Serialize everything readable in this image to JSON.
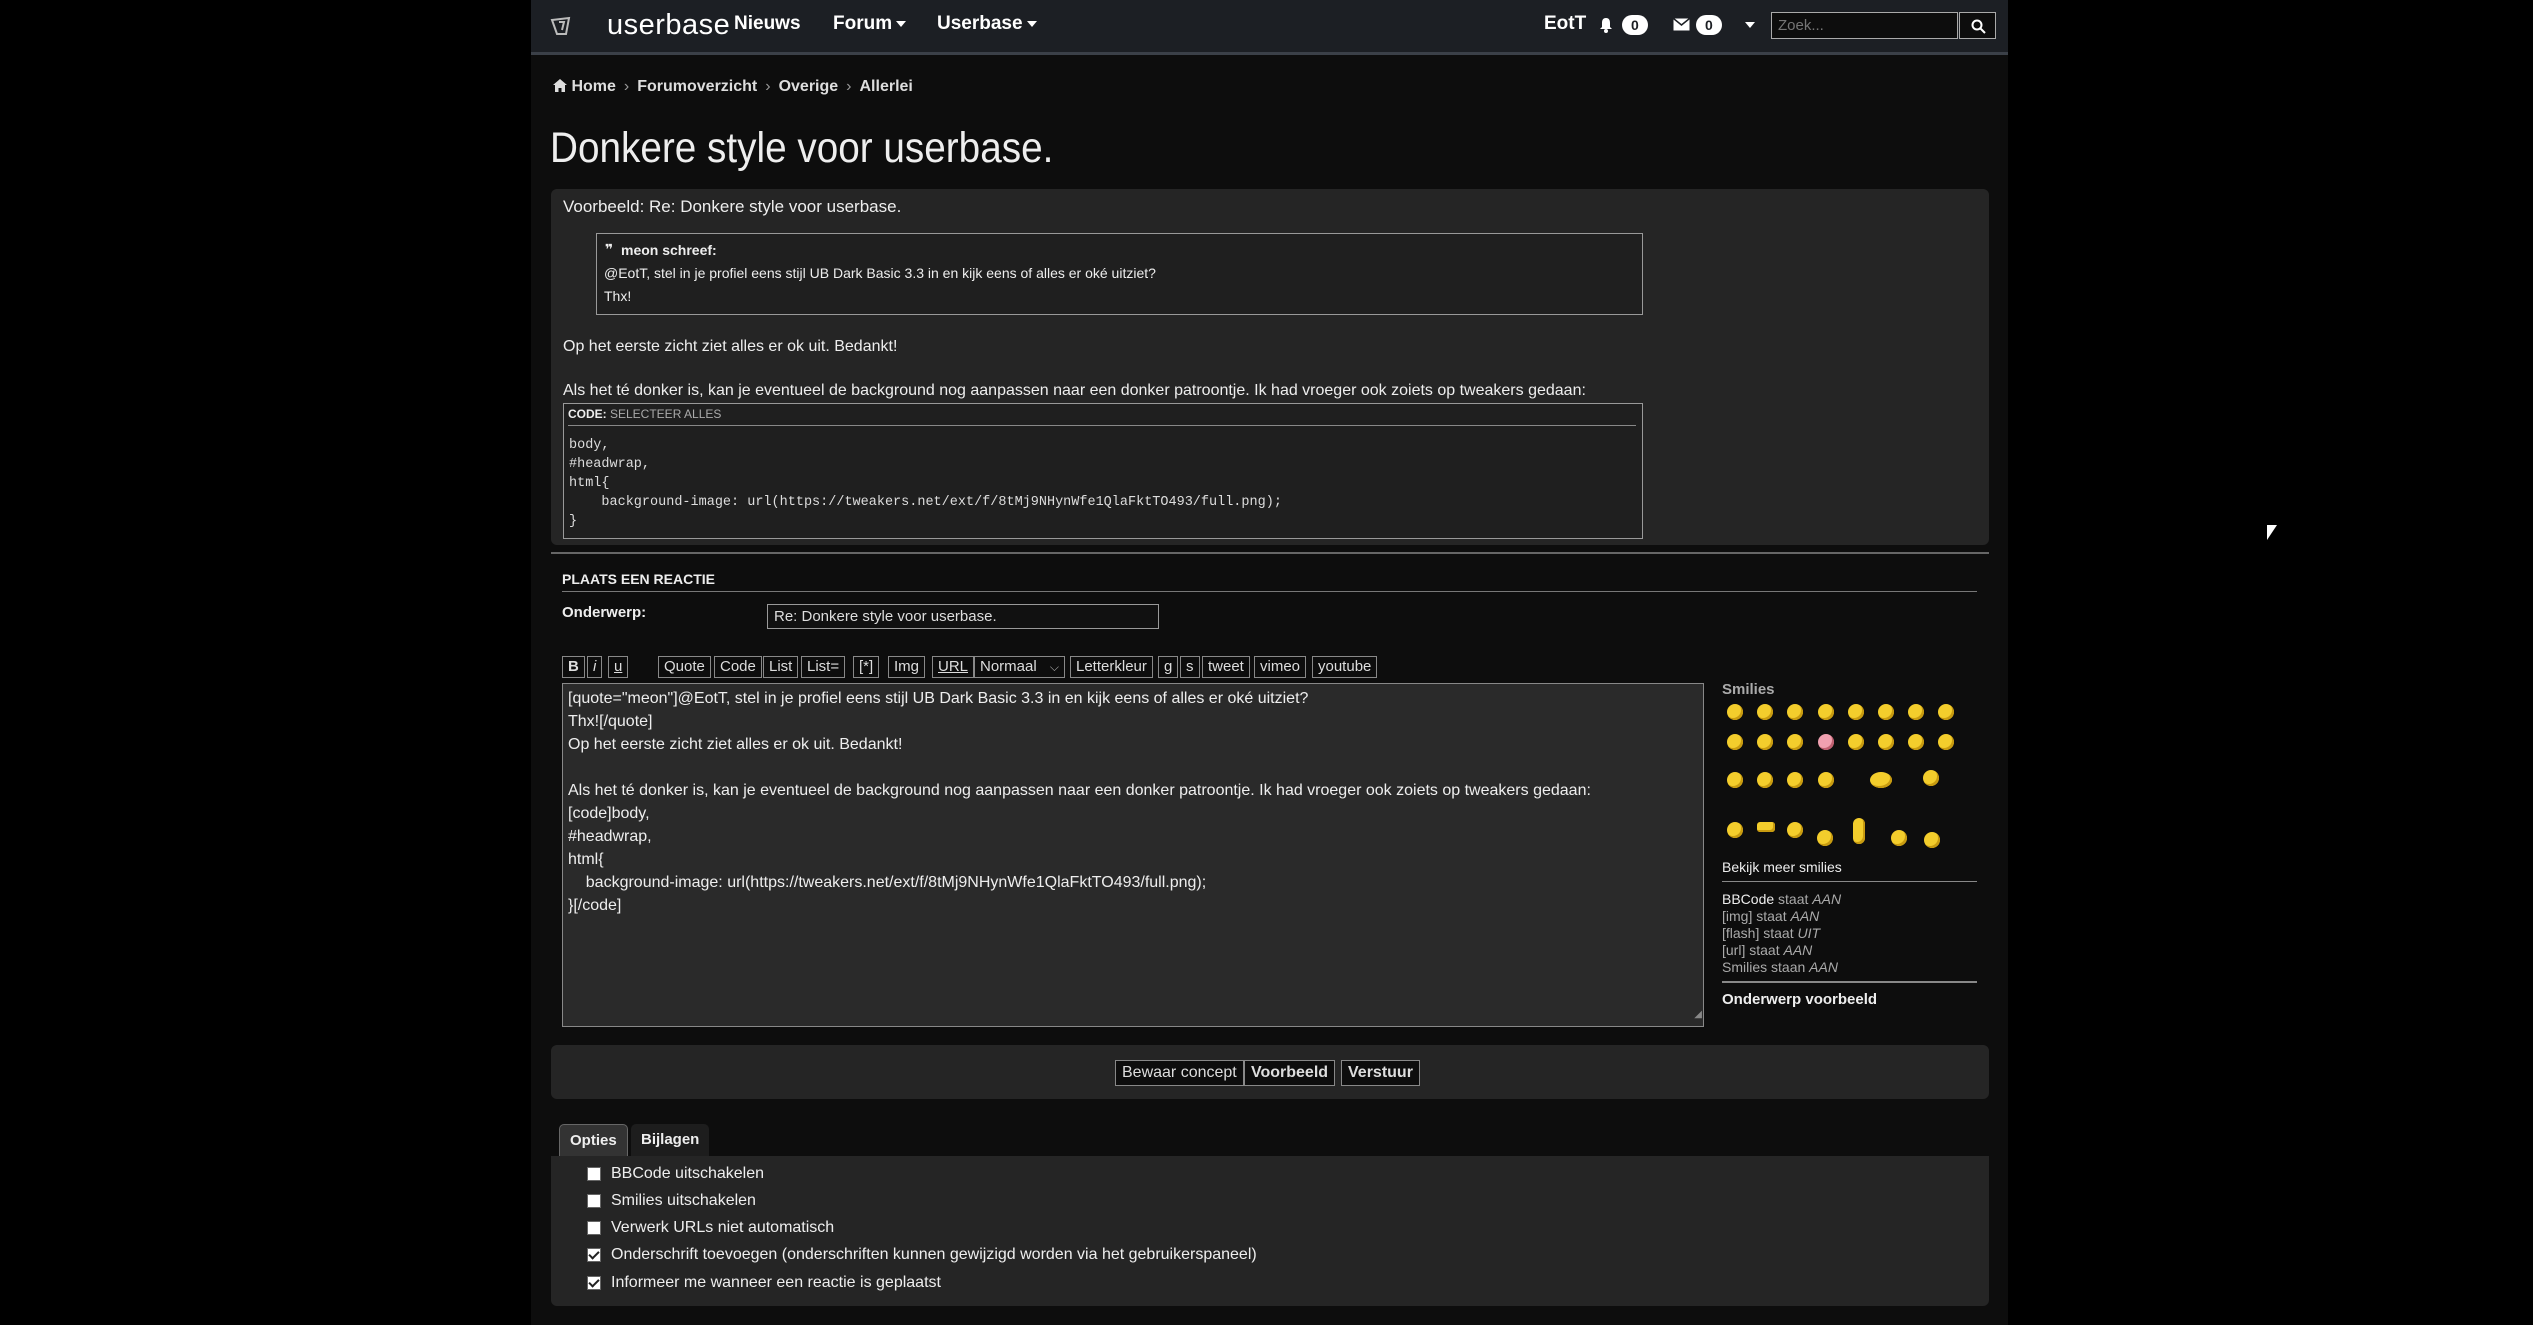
{
  "nav": {
    "logo_icon": "userbase-logo-icon",
    "logo_text": "userbase",
    "items": [
      "Nieuws",
      "Forum",
      "Userbase"
    ],
    "username": "EotT",
    "notifications_count": "0",
    "messages_count": "0",
    "search_placeholder": "Zoek...",
    "search_icon": "search-icon"
  },
  "breadcrumb": [
    "Home",
    "Forumoverzicht",
    "Overige",
    "Allerlei"
  ],
  "page_title": "Donkere style voor userbase.",
  "preview": {
    "heading": "Voorbeeld: Re: Donkere style voor userbase.",
    "quote_author": "meon schreef:",
    "quote_lines": [
      "@EotT, stel in je profiel eens stijl UB Dark Basic 3.3 in en kijk eens of alles er oké uitziet?",
      "Thx!"
    ],
    "para1": "Op het eerste zicht ziet alles er ok uit. Bedankt!",
    "para2": "Als het té donker is, kan je eventueel de background nog aanpassen naar een donker patroontje. Ik had vroeger ook zoiets op tweakers gedaan:",
    "code_label": "CODE:",
    "code_select": "SELECTEER ALLES",
    "code_lines": [
      "body,",
      "#headwrap,",
      "html{",
      "    background-image: url(https://tweakers.net/ext/f/8tMj9NHynWfe1QlaFktTO493/full.png);",
      "}"
    ]
  },
  "form": {
    "heading": "PLAATS EEN REACTIE",
    "subject_label": "Onderwerp:",
    "subject_value": "Re: Donkere style voor userbase.",
    "toolbar": [
      "B",
      "i",
      "u",
      "Quote",
      "Code",
      "List",
      "List=",
      "[*]",
      "Img",
      "URL",
      "Normaal",
      "Letterkleur",
      "g",
      "s",
      "tweet",
      "vimeo",
      "youtube"
    ],
    "editor_lines": [
      "[quote=\"meon\"]@EotT, stel in je profiel eens stijl UB Dark Basic 3.3 in en kijk eens of alles er oké uitziet?",
      "Thx![/quote]",
      "Op het eerste zicht ziet alles er ok uit. Bedankt!",
      "",
      "Als het té donker is, kan je eventueel de background nog aanpassen naar een donker patroontje. Ik had vroeger ook zoiets op tweakers gedaan:",
      "[code]body,",
      "#headwrap,",
      "html{",
      "    background-image: url(https://tweakers.net/ext/f/8tMj9NHynWfe1QlaFktTO493/full.png);",
      "}[/code]"
    ]
  },
  "sidebar": {
    "smilies_title": "Smilies",
    "more_smilies": "Bekijk meer smilies",
    "status": [
      {
        "name": "BBCode",
        "mid": " staat ",
        "state": "AAN"
      },
      {
        "name": "[img]",
        "mid": " staat ",
        "state": "AAN"
      },
      {
        "name": "[flash]",
        "mid": " staat ",
        "state": "UIT"
      },
      {
        "name": "[url]",
        "mid": " staat ",
        "state": "AAN"
      },
      {
        "name": "Smilies",
        "mid": " staan ",
        "state": "AAN"
      }
    ],
    "topic_preview": "Onderwerp voorbeeld"
  },
  "buttons": {
    "save_draft": "Bewaar concept",
    "preview": "Voorbeeld",
    "submit": "Verstuur"
  },
  "tabs": [
    "Opties",
    "Bijlagen"
  ],
  "options": [
    {
      "label": "BBCode uitschakelen",
      "checked": false
    },
    {
      "label": "Smilies uitschakelen",
      "checked": false
    },
    {
      "label": "Verwerk URLs niet automatisch",
      "checked": false
    },
    {
      "label": "Onderschrift toevoegen (onderschriften kunnen gewijzigd worden via het gebruikerspaneel)",
      "checked": true
    },
    {
      "label": "Informeer me wanneer een reactie is geplaatst",
      "checked": true
    }
  ],
  "colors": {
    "page_bg": "#000000",
    "content_bg": "#0d0d0d",
    "panel_bg": "#252525",
    "navbar_bg": "#1c1f24",
    "smiley_yellow": "#f3cd2c"
  }
}
